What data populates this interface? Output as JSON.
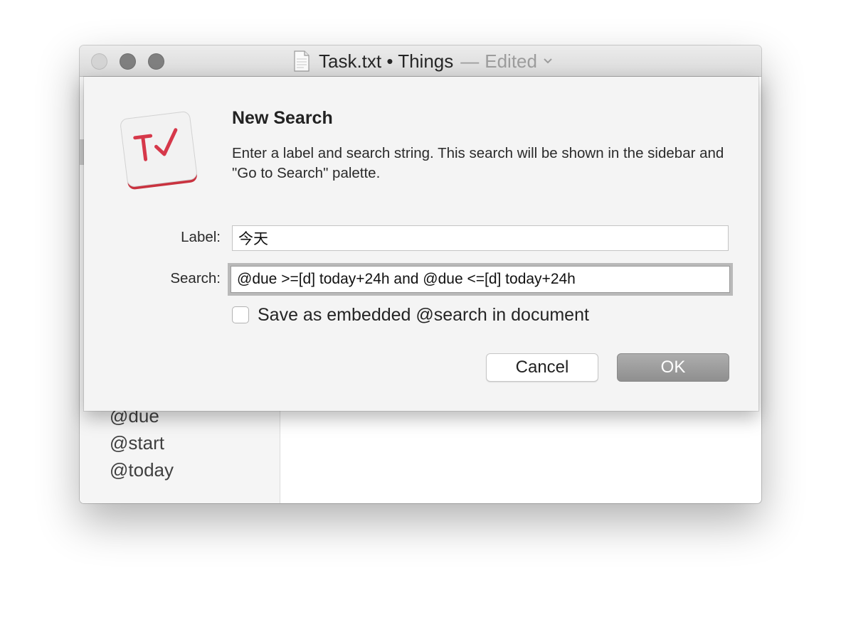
{
  "window": {
    "doc_name": "Task.txt • Things",
    "separator": "—",
    "status": "Edited"
  },
  "sidebar": {
    "items": [
      {
        "label": "@due"
      },
      {
        "label": "@start"
      },
      {
        "label": "@today"
      }
    ]
  },
  "dialog": {
    "title": "New Search",
    "message": "Enter a label and search string. This search will be shown in the sidebar and \"Go to Search\" palette.",
    "label_field": {
      "label": "Label:",
      "value": "今天"
    },
    "search_field": {
      "label": "Search:",
      "value": "@due >=[d] today+24h and @due <=[d] today+24h"
    },
    "embed_checkbox": {
      "label": "Save as embedded @search in document",
      "checked": false
    },
    "buttons": {
      "cancel": "Cancel",
      "ok": "OK"
    }
  },
  "icons": {
    "window_controls": [
      "close-button",
      "minimize-button",
      "zoom-button"
    ],
    "document": "document-icon",
    "chevron": "chevron-down-icon",
    "app": "taskpaper-app-icon"
  },
  "colors": {
    "app_icon_accent": "#d6384a",
    "ok_button": "#9a9a9a"
  }
}
